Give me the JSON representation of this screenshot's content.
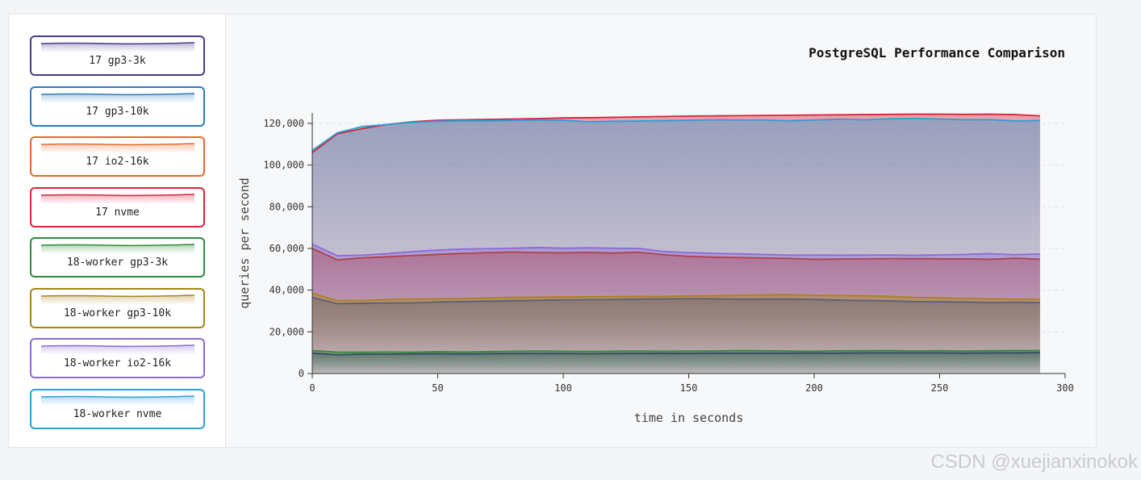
{
  "legend": [
    {
      "label": "17 gp3-3k",
      "color": "#4a3a8a"
    },
    {
      "label": "17 gp3-10k",
      "color": "#2b7bbf"
    },
    {
      "label": "17 io2-16k",
      "color": "#e8682a"
    },
    {
      "label": "17 nvme",
      "color": "#d6243a"
    },
    {
      "label": "18-worker gp3-3k",
      "color": "#2e8b3a"
    },
    {
      "label": "18-worker gp3-10k",
      "color": "#a8821a"
    },
    {
      "label": "18-worker io2-16k",
      "color": "#8a6ad8"
    },
    {
      "label": "18-worker nvme",
      "color": "#2aa0d8"
    }
  ],
  "watermark": "CSDN @xuejianxinokok",
  "chart_data": {
    "type": "area",
    "title": "PostgreSQL Performance Comparison",
    "xlabel": "time in seconds",
    "ylabel": "queries per second",
    "xlim": [
      0,
      300
    ],
    "ylim": [
      0,
      125000
    ],
    "xticks": [
      0,
      50,
      100,
      150,
      200,
      250,
      300
    ],
    "yticks": [
      0,
      20000,
      40000,
      60000,
      80000,
      100000,
      120000
    ],
    "ytick_labels": [
      "0",
      "20,000",
      "40,000",
      "60,000",
      "80,000",
      "100,000",
      "120,000"
    ],
    "grid": "horizontal dashed",
    "x": [
      0,
      10,
      20,
      30,
      40,
      50,
      60,
      70,
      80,
      90,
      100,
      110,
      120,
      130,
      140,
      150,
      160,
      170,
      180,
      190,
      200,
      210,
      220,
      230,
      240,
      250,
      260,
      270,
      280,
      290
    ],
    "series": [
      {
        "color": "#d6243a",
        "values": [
          106000,
          115000,
          117500,
          119500,
          120800,
          121500,
          121700,
          121900,
          122100,
          122300,
          122600,
          122700,
          122900,
          123100,
          123300,
          123500,
          123600,
          123700,
          123800,
          123900,
          124000,
          124100,
          124200,
          124300,
          124400,
          124400,
          124300,
          124400,
          124200,
          123600
        ]
      },
      {
        "color": "#2aa0d8",
        "values": [
          107000,
          115500,
          118500,
          119500,
          120500,
          121000,
          121300,
          121200,
          121400,
          121600,
          121500,
          120800,
          121000,
          121100,
          121300,
          121500,
          121700,
          121600,
          121600,
          121200,
          121600,
          122000,
          121700,
          122200,
          122400,
          122100,
          121700,
          121800,
          121100,
          121400
        ]
      },
      {
        "color": "#8a6ad8",
        "values": [
          62000,
          56500,
          56800,
          57500,
          58500,
          59200,
          59700,
          59900,
          60100,
          60400,
          60100,
          60300,
          60100,
          60000,
          58500,
          58000,
          57600,
          57400,
          57100,
          56800,
          56800,
          56800,
          56800,
          56900,
          56700,
          56900,
          57100,
          57500,
          57000,
          57300
        ]
      },
      {
        "color": "#b04048",
        "values": [
          60000,
          54500,
          55500,
          56000,
          56600,
          57100,
          57600,
          58000,
          58300,
          58000,
          57900,
          58100,
          57800,
          58200,
          57000,
          56200,
          55800,
          55600,
          55400,
          55200,
          54800,
          54900,
          55000,
          55100,
          55100,
          55000,
          55000,
          54800,
          55300,
          54800
        ]
      },
      {
        "color": "#a8821a",
        "values": [
          38500,
          35000,
          35000,
          35500,
          35700,
          35800,
          36000,
          36200,
          36500,
          36600,
          36700,
          36800,
          36900,
          37000,
          37000,
          37200,
          37300,
          37500,
          37700,
          37800,
          37500,
          37400,
          37300,
          37000,
          36500,
          36300,
          36000,
          35800,
          35700,
          35600
        ]
      },
      {
        "color": "#5a6070",
        "values": [
          36500,
          33500,
          33700,
          33800,
          33900,
          34300,
          34500,
          34700,
          34900,
          35100,
          35300,
          35400,
          35500,
          35700,
          35800,
          35900,
          35800,
          35700,
          35700,
          35700,
          35500,
          35200,
          35000,
          34800,
          34500,
          34400,
          34300,
          34000,
          34200,
          34000
        ]
      },
      {
        "color": "#2e8b3a",
        "values": [
          11000,
          10200,
          10200,
          10300,
          10200,
          10500,
          10300,
          10500,
          10700,
          10800,
          10700,
          10600,
          10700,
          10800,
          10700,
          10800,
          10800,
          11000,
          10900,
          10800,
          10700,
          10900,
          10900,
          11000,
          10800,
          10900,
          10800,
          10900,
          11000,
          11000
        ]
      },
      {
        "color": "#34495e",
        "values": [
          9800,
          9000,
          9300,
          9300,
          9400,
          9500,
          9400,
          9500,
          9600,
          9600,
          9600,
          9500,
          9600,
          9700,
          9700,
          9700,
          9800,
          9800,
          9800,
          9800,
          9800,
          9800,
          9900,
          9900,
          9900,
          9900,
          9800,
          9900,
          9900,
          10000
        ]
      }
    ]
  }
}
